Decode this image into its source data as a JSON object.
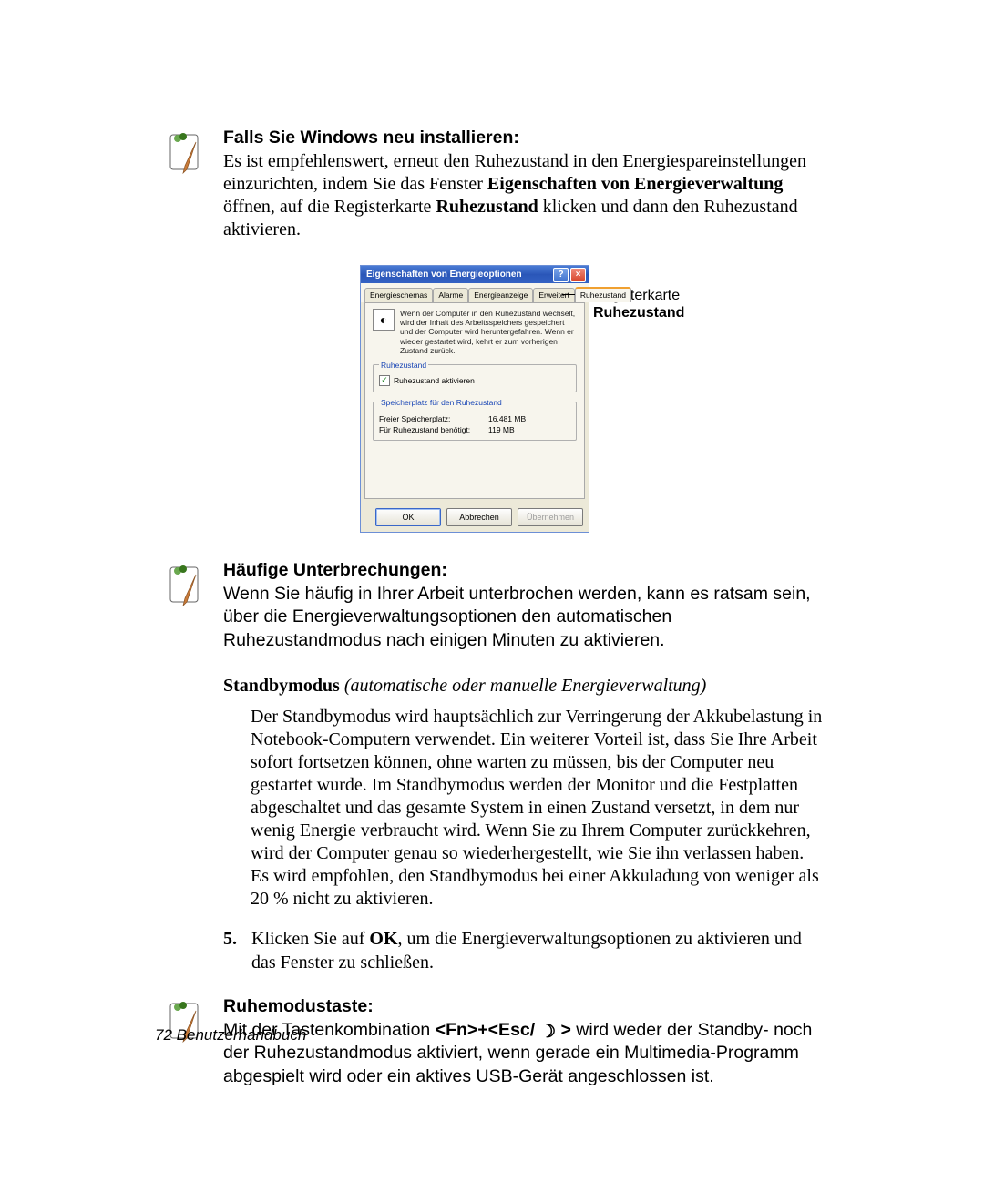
{
  "notes": {
    "reinstall": {
      "title": "Falls Sie Windows neu installieren:",
      "text_before1": "Es ist empfehlenswert, erneut den Ruhezustand in den Energiespareinstellungen einzurichten, indem Sie das Fenster ",
      "strong1": "Eigenschaften von Energieverwaltung",
      "text_mid1": " öffnen, auf die Registerkarte ",
      "strong2": "Ruhezustand",
      "text_after1": " klicken und dann den Ruhezustand aktivieren."
    },
    "interrupts": {
      "title": "Häufige Unterbrechungen:",
      "body": "Wenn Sie häufig in Ihrer Arbeit unterbrochen werden, kann es ratsam sein, über die Energieverwaltungsoptionen den automatischen Ruhezustandmodus nach einigen Minuten zu aktivieren."
    },
    "sleepkey": {
      "title": "Ruhemodustaste:",
      "pre": "Mit der Tastenkombination ",
      "shortcut": "<Fn>+<Esc/ ",
      "icon": "☽",
      "shortcut_end": " >",
      "post": " wird weder der Standby- noch der Ruhezustandmodus aktiviert, wenn gerade ein Multimedia-Programm abgespielt wird oder ein aktives USB-Gerät angeschlossen ist."
    }
  },
  "dialog": {
    "title": "Eigenschaften von Energieoptionen",
    "help_label": "?",
    "close_label": "×",
    "tabs": [
      "Energieschemas",
      "Alarme",
      "Energieanzeige",
      "Erweitert",
      "Ruhezustand"
    ],
    "selected_tab": 4,
    "description": "Wenn der Computer in den Ruhezustand wechselt, wird der Inhalt des Arbeitsspeichers gespeichert und der Computer wird heruntergefahren. Wenn er wieder gestartet wird, kehrt er zum vorherigen Zustand zurück.",
    "group1": {
      "legend": "Ruhezustand",
      "checkbox_label": "Ruhezustand aktivieren",
      "checked": true
    },
    "group2": {
      "legend": "Speicherplatz für den Ruhezustand",
      "row1_k": "Freier Speicherplatz:",
      "row1_v": "16.481 MB",
      "row2_k": "Für Ruhezustand benötigt:",
      "row2_v": "119 MB"
    },
    "buttons": {
      "ok": "OK",
      "cancel": "Abbrechen",
      "apply": "Übernehmen"
    }
  },
  "callout": {
    "line1": "Registerkarte",
    "line2": "Ruhezustand"
  },
  "standby": {
    "head_strong": "Standbymodus",
    "head_em": " (automatische oder manuelle Energieverwaltung)",
    "body": "Der Standbymodus wird hauptsächlich zur Verringerung der Akkubelastung in Notebook-Computern verwendet. Ein weiterer Vorteil ist, dass Sie Ihre Arbeit sofort fortsetzen können, ohne warten zu müssen, bis der Computer neu gestartet wurde. Im Standbymodus werden der Monitor und die Festplatten abgeschaltet und das gesamte System in einen Zustand versetzt, in dem nur wenig Energie verbraucht wird. Wenn Sie zu Ihrem Computer zurückkehren, wird der Computer genau so wiederhergestellt, wie Sie ihn verlassen haben. Es wird empfohlen, den Standbymodus bei einer Akkuladung von weniger als 20 % nicht zu aktivieren."
  },
  "step5": {
    "num": "5.",
    "pre": "Klicken Sie auf ",
    "strong": "OK",
    "post": ", um die Energieverwaltungsoptionen zu aktivieren und das Fenster zu schließen."
  },
  "footer": {
    "page": "72",
    "label": "  Benutzerhandbuch"
  }
}
